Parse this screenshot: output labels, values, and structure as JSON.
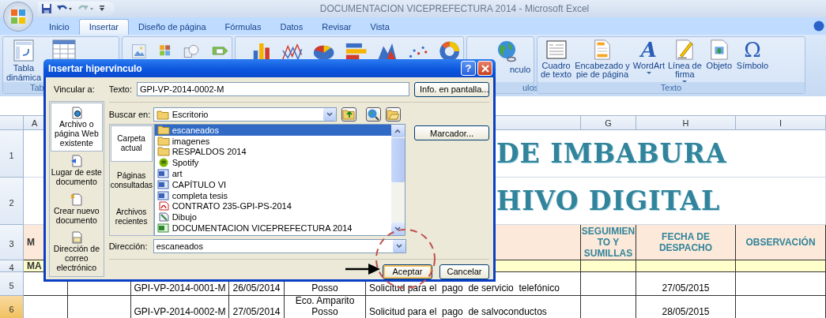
{
  "window": {
    "title": "DOCUMENTACION VICEPREFECTURA 2014 - Microsoft Excel"
  },
  "ribbon_tabs": [
    {
      "label": "Inicio",
      "selected": false
    },
    {
      "label": "Insertar",
      "selected": true
    },
    {
      "label": "Diseño de página",
      "selected": false
    },
    {
      "label": "Fórmulas",
      "selected": false
    },
    {
      "label": "Datos",
      "selected": false
    },
    {
      "label": "Revisar",
      "selected": false
    },
    {
      "label": "Vista",
      "selected": false
    }
  ],
  "ribbon": {
    "pivot_button": "Tabla\ndinámica",
    "tables_group": "Tab",
    "link_button": "nculo",
    "links_group": "ulos",
    "text_group": {
      "label": "Texto",
      "buttons": [
        {
          "label": "Cuadro\nde texto",
          "dropdown": false
        },
        {
          "label": "Encabezado y\npie de página",
          "dropdown": false
        },
        {
          "label": "WordArt",
          "dropdown": true,
          "glyph": "A"
        },
        {
          "label": "Línea de\nfirma",
          "dropdown": true
        },
        {
          "label": "Objeto",
          "dropdown": false
        },
        {
          "label": "Símbolo",
          "dropdown": false,
          "glyph": "Ω"
        }
      ]
    }
  },
  "sheet": {
    "column_headers": [
      "A",
      "G",
      "H",
      "I"
    ],
    "rows": [
      {
        "number": "1",
        "kind": "title",
        "selected": false,
        "cells": [
          "",
          "",
          "",
          "",
          "",
          "DE IMBABURA"
        ]
      },
      {
        "number": "2",
        "kind": "title",
        "selected": false,
        "cells": [
          "",
          "",
          "",
          "",
          "",
          "HIVO DIGITAL"
        ]
      },
      {
        "number": "3",
        "kind": "header",
        "selected": false,
        "cells": [
          "M",
          "",
          "",
          "",
          "",
          "",
          "SEGUIMIEN TO Y SUMILLAS",
          "FECHA DE DESPACHO",
          "OBSERVACIÓN"
        ]
      },
      {
        "number": "4",
        "kind": "section",
        "selected": false,
        "cells": [
          "MA",
          "",
          "",
          "",
          "",
          "",
          "",
          "",
          ""
        ]
      },
      {
        "number": "5",
        "kind": "data",
        "selected": false,
        "cells": [
          "",
          "",
          "GPI-VP-2014-0001-M",
          "26/05/2014",
          "Posso",
          "Solicitud para el  pago  de servicio  telefónico",
          "",
          "27/05/2015",
          ""
        ]
      },
      {
        "number": "6",
        "kind": "data",
        "selected": true,
        "cells": [
          "",
          "",
          "GPI-VP-2014-0002-M",
          "27/05/2014",
          "Eco. Amparito Posso",
          "Solicitud para el  pago  de salvoconductos",
          "",
          "28/05/2015",
          ""
        ]
      }
    ]
  },
  "dialog": {
    "title": "Insertar hipervínculo",
    "help_button": "?",
    "link_to_label": "Vincular a:",
    "link_targets": [
      {
        "label": "Archivo o\npágina Web\nexistente",
        "selected": true
      },
      {
        "label": "Lugar de este\ndocumento",
        "selected": false
      },
      {
        "label": "Crear nuevo\ndocumento",
        "selected": false
      },
      {
        "label": "Dirección de\ncorreo\nelectrónico",
        "selected": false
      }
    ],
    "text_label": "Texto:",
    "text_value": "GPI-VP-2014-0002-M",
    "screentip_button": "Info. en pantalla...",
    "look_in_label": "Buscar en:",
    "look_in_value": "Escritorio",
    "views": [
      {
        "label": "Carpeta\nactual",
        "selected": true
      },
      {
        "label": "Páginas\nconsultadas",
        "selected": false
      },
      {
        "label": "Archivos\nrecientes",
        "selected": false
      }
    ],
    "files": [
      {
        "name": "escaneados",
        "kind": "folder",
        "selected": true
      },
      {
        "name": "imagenes",
        "kind": "folder",
        "selected": false
      },
      {
        "name": "RESPALDOS 2014",
        "kind": "folder",
        "selected": false
      },
      {
        "name": "Spotify",
        "kind": "app",
        "selected": false
      },
      {
        "name": "art",
        "kind": "word",
        "selected": false
      },
      {
        "name": "CAPÍTULO VI",
        "kind": "word",
        "selected": false
      },
      {
        "name": "completa tesis",
        "kind": "word",
        "selected": false
      },
      {
        "name": "CONTRATO 235-GPI-PS-2014",
        "kind": "pdf",
        "selected": false
      },
      {
        "name": "Dibujo",
        "kind": "image",
        "selected": false
      },
      {
        "name": "DOCUMENTACION VICEPREFECTURA 2014",
        "kind": "excel",
        "selected": false
      }
    ],
    "bookmark_button": "Marcador...",
    "address_label": "Dirección:",
    "address_value": "escaneados",
    "ok_button": "Aceptar",
    "cancel_button": "Cancelar"
  }
}
